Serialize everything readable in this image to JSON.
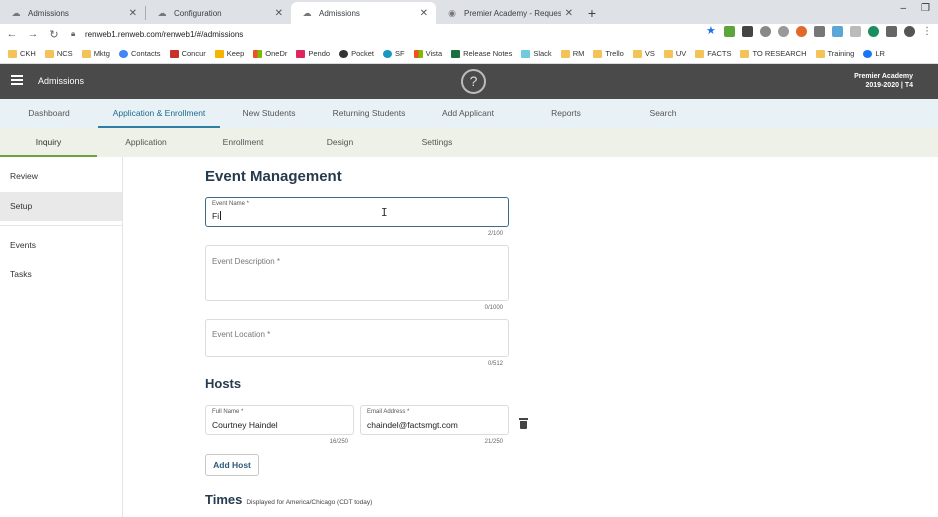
{
  "browser": {
    "tabs": [
      {
        "label": "Admissions",
        "active": false
      },
      {
        "label": "Configuration",
        "active": false
      },
      {
        "label": "Admissions",
        "active": true
      },
      {
        "label": "Premier Academy - Request Info",
        "active": false
      }
    ],
    "new_tab": "+",
    "url": "renweb1.renweb.com/renweb1/#/admissions",
    "bookmarks": [
      "CKH",
      "NCS",
      "Mktg",
      "Contacts",
      "Concur",
      "Keep",
      "OneDr",
      "Pendo",
      "Pocket",
      "SF",
      "Vista",
      "Release Notes",
      "Slack",
      "RM",
      "Trello",
      "VS",
      "UV",
      "FACTS",
      "TO RESEARCH",
      "Training",
      "LR"
    ]
  },
  "header": {
    "title": "Admissions",
    "help_symbol": "?",
    "school_name": "Premier Academy",
    "term": "2019-2020 | T4"
  },
  "main_nav": [
    "Dashboard",
    "Application & Enrollment",
    "New Students",
    "Returning Students",
    "Add Applicant",
    "Reports",
    "Search"
  ],
  "sub_nav": [
    "Inquiry",
    "Application",
    "Enrollment",
    "Design",
    "Settings"
  ],
  "sidebar": {
    "items": [
      "Review",
      "Setup",
      "Events",
      "Tasks"
    ],
    "selected": "Setup"
  },
  "form": {
    "title": "Event Management",
    "event_name": {
      "label": "Event Name *",
      "value": "Fi",
      "counter": "2/100"
    },
    "event_description": {
      "placeholder": "Event Description *",
      "counter": "0/1000"
    },
    "event_location": {
      "placeholder": "Event Location *",
      "counter": "0/512"
    },
    "hosts": {
      "title": "Hosts",
      "full_name_label": "Full Name *",
      "full_name_value": "Courtney Haindel",
      "full_name_counter": "16/250",
      "email_label": "Email Address *",
      "email_value": "chaindel@factsmgt.com",
      "email_counter": "21/250",
      "add_host_label": "Add Host"
    },
    "times": {
      "title": "Times",
      "subtitle": "Displayed for America/Chicago (CDT today)"
    }
  }
}
